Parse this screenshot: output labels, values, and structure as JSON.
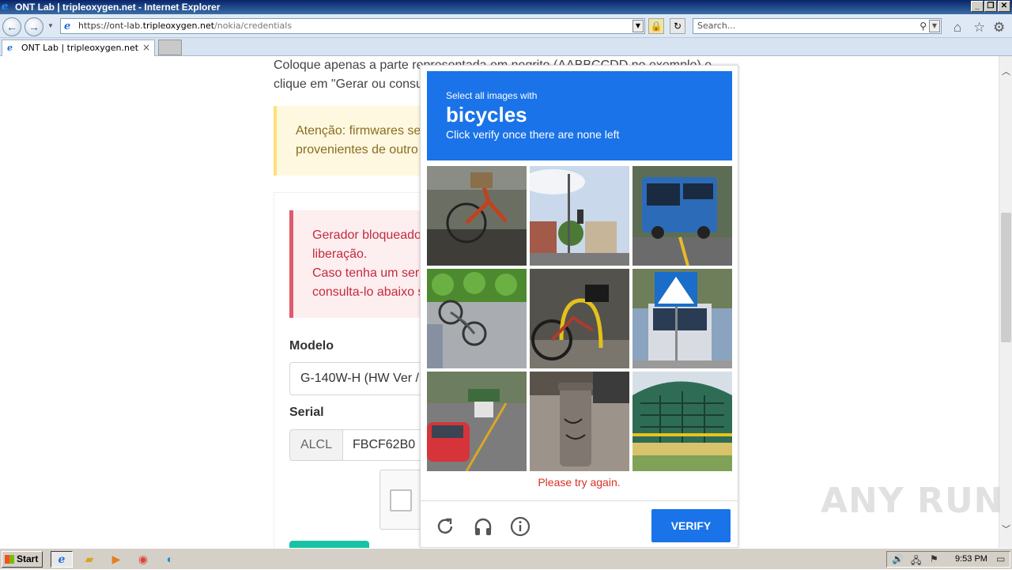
{
  "window": {
    "title": "ONT Lab | tripleoxygen.net - Internet Explorer",
    "controls": {
      "minimize": "_",
      "restore": "❐",
      "close": "✕"
    }
  },
  "toolbar": {
    "back_icon": "back-arrow-icon",
    "forward_icon": "forward-arrow-icon",
    "address_prefix": "https://ont-lab.",
    "address_domain": "tripleoxygen.net",
    "address_path": "/nokia/credentials",
    "search_placeholder": "Search...",
    "right_icons": [
      "home-icon",
      "star-icon",
      "gear-icon"
    ]
  },
  "tabs": [
    {
      "label": "ONT Lab | tripleoxygen.net",
      "close": "×"
    }
  ],
  "page": {
    "intro_line1": "Coloque apenas a parte representada em negrito (AABBCCDD no exemplo) e",
    "intro_line2": "clique em \"Gerar ou consu",
    "warning_line1": "Atenção: firmwares ser",
    "warning_line2": "provenientes de outro",
    "danger_line1": "Gerador bloqueado",
    "danger_line2": "liberação.",
    "danger_line3": "Caso tenha um seria",
    "danger_line4": "consulta-lo abaixo s",
    "model_label": "Modelo",
    "model_value": "G-140W-H (HW Ver /",
    "serial_label": "Serial",
    "serial_prefix": "ALCL",
    "serial_value": "FBCF62B0"
  },
  "captcha": {
    "instruction_small": "Select all images with",
    "target": "bicycles",
    "instruction_sub": "Click verify once there are none left",
    "tiles": [
      "bicycle-basket",
      "street-traffic-lights",
      "blue-bus",
      "bicycle-by-hedge",
      "bicycle-at-rack",
      "bus-crosswalk-sign",
      "cars-on-street",
      "fire-hydrant",
      "building-facade"
    ],
    "error": "Please try again.",
    "verify_label": "VERIFY",
    "footer_icons": [
      "refresh-icon",
      "headphones-icon",
      "info-icon"
    ]
  },
  "watermark": "ANY RUN",
  "taskbar": {
    "start_label": "Start",
    "apps": [
      "ie-icon",
      "folder-icon",
      "media-player-icon",
      "chrome-icon",
      "edge-icon"
    ],
    "clock": "9:53 PM"
  }
}
